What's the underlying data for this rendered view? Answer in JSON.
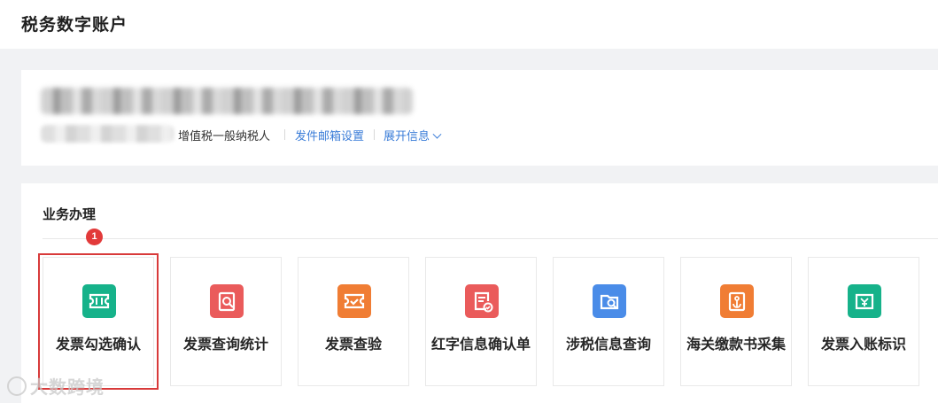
{
  "header": {
    "title": "税务数字账户"
  },
  "account_info": {
    "taxpayer_type": "增值税一般纳税人",
    "email_settings_link": "发件邮箱设置",
    "expand_info_link": "展开信息"
  },
  "business": {
    "section_title": "业务办理",
    "step_badge": "1",
    "tiles": [
      {
        "label": "发票勾选确认",
        "icon": "ticket-icon",
        "color": "#16b28a"
      },
      {
        "label": "发票查询统计",
        "icon": "document-search-icon",
        "color": "#ea5b5b"
      },
      {
        "label": "发票查验",
        "icon": "ticket-check-icon",
        "color": "#f07d34"
      },
      {
        "label": "红字信息确认单",
        "icon": "document-check-icon",
        "color": "#ea5b5b"
      },
      {
        "label": "涉税信息查询",
        "icon": "folder-search-icon",
        "color": "#4a8ce8"
      },
      {
        "label": "海关缴款书采集",
        "icon": "anchor-doc-icon",
        "color": "#f07d34"
      },
      {
        "label": "发票入账标识",
        "icon": "inbox-ticket-icon",
        "color": "#16b28a"
      }
    ]
  },
  "watermark": {
    "text": "大数跨境"
  }
}
